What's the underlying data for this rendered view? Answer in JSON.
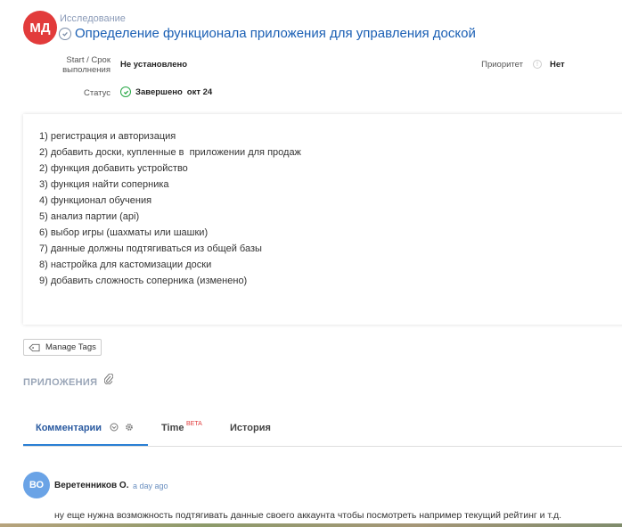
{
  "header": {
    "avatar_initials": "МД",
    "breadcrumb": "Исследование",
    "title": "Определение функционала приложения для управления доской"
  },
  "fields": {
    "start_label_line1": "Start / Срок",
    "start_label_line2": "выполнения",
    "start_value": "Не установлено",
    "priority_label": "Приоритет",
    "priority_value": "Нет",
    "status_label": "Статус",
    "status_value": "Завершено",
    "status_date": "окт 24"
  },
  "description": {
    "lines": [
      "1) регистрация и авторизация",
      "2) добавить доски, купленные в  приложении для продаж",
      "2) функция добавить устройство",
      "3) функция найти соперника",
      "4) функционал обучения",
      "5) анализ партии (api)",
      "6) выбор игры (шахматы или шашки)",
      "7) данные должны подтягиваться из общей базы",
      "8) настройка для кастомизации доски",
      "9) добавить сложность соперника (изменено)"
    ]
  },
  "tags": {
    "manage_label": "Manage Tags"
  },
  "attachments": {
    "title": "ПРИЛОЖЕНИЯ"
  },
  "tabs": {
    "comments": "Комментарии",
    "time": "Time",
    "beta": "BETA",
    "history": "История"
  },
  "comment": {
    "avatar_initials": "ВО",
    "author": "Веретенников О.",
    "time": "a day ago",
    "text": "ну еще нужна возможность подтягивать данные своего аккаунта чтобы посмотреть например текущий рейтинг и т.д."
  },
  "colors": {
    "accent": "#2a7fd4",
    "title": "#1a5fb4",
    "avatar_red": "#e23b3b",
    "status_green": "#27a745",
    "beta_red": "#e03c3c"
  }
}
